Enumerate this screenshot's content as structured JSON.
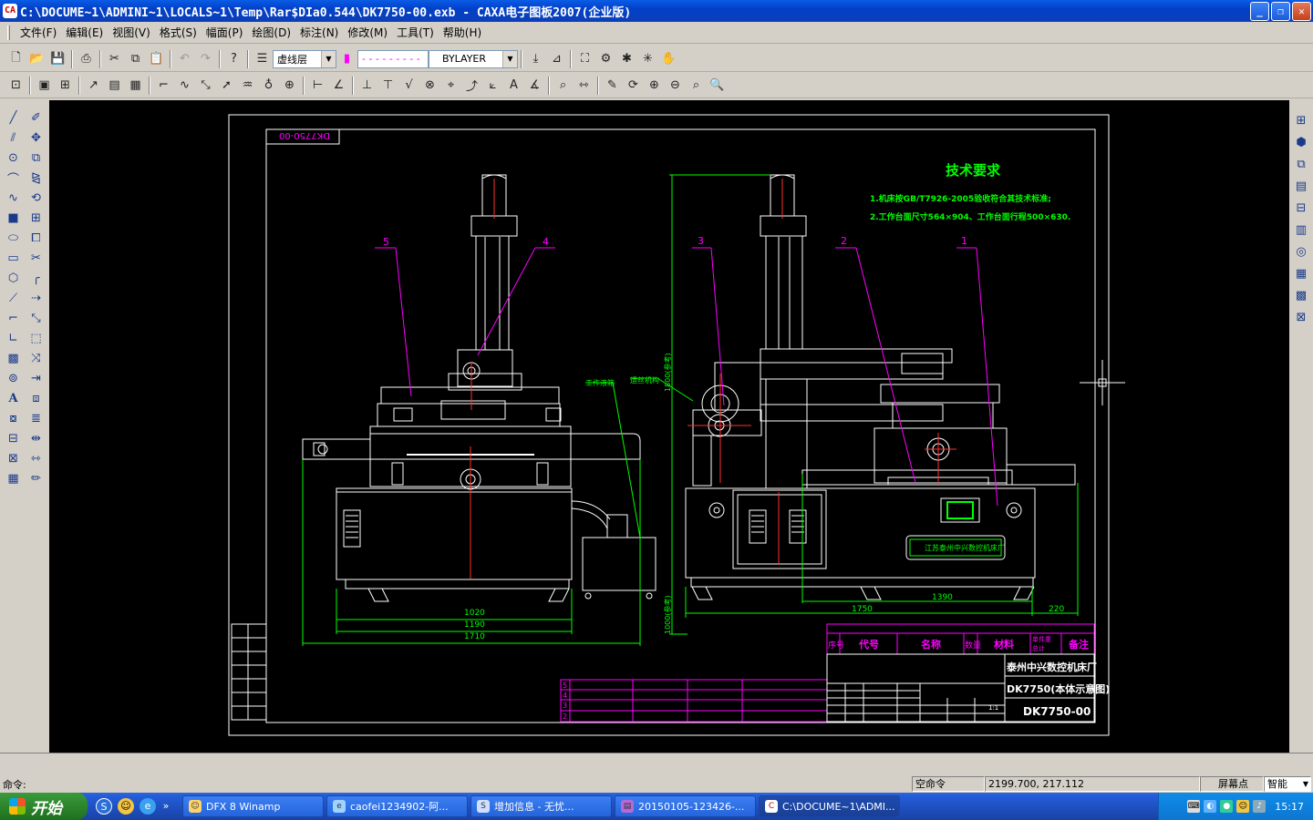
{
  "window": {
    "title": "C:\\DOCUME~1\\ADMINI~1\\LOCALS~1\\Temp\\Rar$DIa0.544\\DK7750-00.exb - CAXA电子图板2007(企业版)",
    "app_icon_text": "CA"
  },
  "menu": [
    "文件(F)",
    "编辑(E)",
    "视图(V)",
    "格式(S)",
    "幅面(P)",
    "绘图(D)",
    "标注(N)",
    "修改(M)",
    "工具(T)",
    "帮助(H)"
  ],
  "toolbar": {
    "layer_value": "虚线层",
    "linetype_value": "- - - - - - - - -",
    "linewidth_value": "BYLAYER"
  },
  "drawing": {
    "frame_code": "DK7750-00",
    "tech_title": "技术要求",
    "tech_req_1": "1.机床按GB/T7926-2005验收符合其技术标准;",
    "tech_req_2": "2.工作台面尺寸564×904、工作台面行程500×630.",
    "callout_1": "1",
    "callout_2": "2",
    "callout_3": "3",
    "callout_4": "4",
    "callout_5": "5",
    "label_wire": "工作液箱",
    "label_motor": "运丝机构",
    "dim_1020": "1020",
    "dim_1190": "1190",
    "dim_1710": "1710",
    "dim_1750": "1750",
    "dim_1390": "1390",
    "dim_220": "220",
    "dim_vertical_left": "1000(参考)",
    "dim_vertical_right": "1800(参考)",
    "plate_text": "江苏泰州中兴数控机床厂",
    "tb_header_seq": "序号",
    "tb_header_code": "代号",
    "tb_header_name": "名称",
    "tb_header_qty": "数量",
    "tb_header_mat": "材料",
    "tb_header_weight": "单件重",
    "tb_header_total": "总计",
    "tb_header_note": "备注",
    "company": "泰州中兴数控机床厂",
    "drawing_name": "DK7750(本体示意图)",
    "drawing_number": "DK7750-00",
    "scale": "1:1",
    "rev_rows": [
      "5",
      "4",
      "3",
      "2"
    ]
  },
  "status": {
    "command_label": "命令:",
    "prompt": "空命令",
    "coords": "2199.700, 217.112",
    "snap_label": "屏幕点",
    "mode_value": "智能"
  },
  "taskbar": {
    "start_label": "开始",
    "tasks": [
      "DFX 8 Winamp",
      "caofei1234902-阿...",
      "增加信息 - 无忧...",
      "20150105-123426-...",
      "C:\\DOCUME~1\\ADMI..."
    ],
    "clock": "15:17"
  },
  "colors": {
    "canvas_bg": "#000000",
    "cad_white": "#ffffff",
    "cad_green": "#00ff00",
    "cad_magenta": "#ff00ff",
    "cad_red": "#ff3030"
  }
}
